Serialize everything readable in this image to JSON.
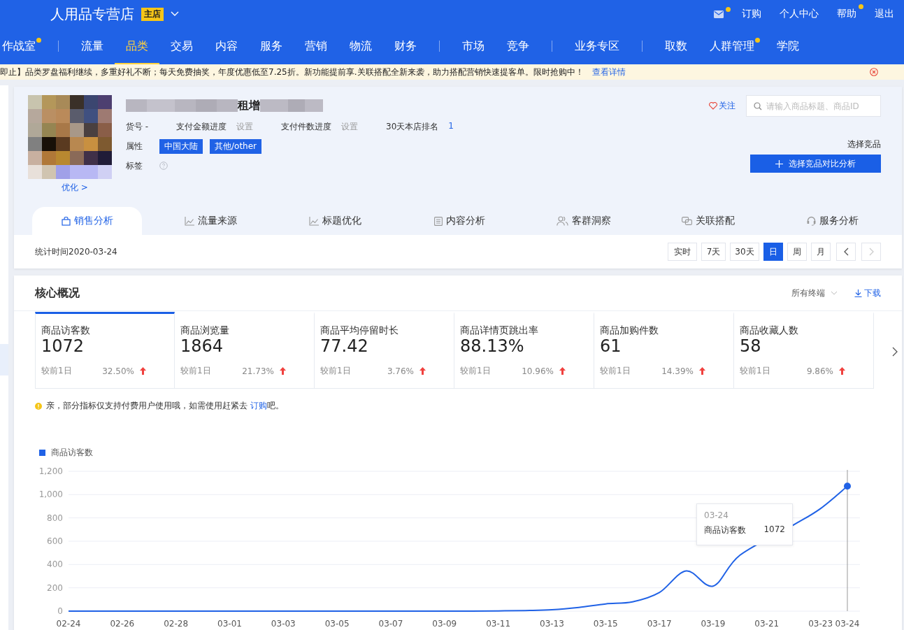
{
  "header": {
    "store_name": "人用品专营店",
    "store_badge": "主店",
    "links": [
      {
        "kind": "mail",
        "dot": true
      },
      {
        "label": "订购",
        "kind": "text",
        "dot": false
      },
      {
        "label": "个人中心",
        "kind": "text",
        "dot": false
      },
      {
        "label": "帮助",
        "kind": "text",
        "dot": true
      },
      {
        "label": "退出",
        "kind": "text",
        "dot": false
      }
    ]
  },
  "nav": [
    {
      "label": "作战室",
      "selected": false,
      "dot": true,
      "divider": true
    },
    {
      "label": "流量",
      "selected": false,
      "dot": false,
      "divider": false
    },
    {
      "label": "品类",
      "selected": true,
      "dot": false,
      "divider": false
    },
    {
      "label": "交易",
      "selected": false,
      "dot": false,
      "divider": false
    },
    {
      "label": "内容",
      "selected": false,
      "dot": false,
      "divider": false
    },
    {
      "label": "服务",
      "selected": false,
      "dot": false,
      "divider": false
    },
    {
      "label": "营销",
      "selected": false,
      "dot": false,
      "divider": false
    },
    {
      "label": "物流",
      "selected": false,
      "dot": false,
      "divider": false
    },
    {
      "label": "财务",
      "selected": false,
      "dot": false,
      "divider": true
    },
    {
      "label": "市场",
      "selected": false,
      "dot": false,
      "divider": false
    },
    {
      "label": "竞争",
      "selected": false,
      "dot": false,
      "divider": true
    },
    {
      "label": "业务专区",
      "selected": false,
      "dot": false,
      "divider": true
    },
    {
      "label": "取数",
      "selected": false,
      "dot": false,
      "divider": false
    },
    {
      "label": "人群管理",
      "selected": false,
      "dot": true,
      "divider": false
    },
    {
      "label": "学院",
      "selected": false,
      "dot": false,
      "divider": false
    }
  ],
  "notice": {
    "text": "即止】品类罗盘福利继续，多重好礼不断；每天免费抽奖，年度优惠低至7.25折。新功能提前享.关联搭配全新来袭，助力搭配营销快速提客单。限时抢购中！",
    "link": "查看详情"
  },
  "product": {
    "title": "租增",
    "optimize_link": "优化 >",
    "fields": [
      {
        "label": "货号 -"
      },
      {
        "label": "支付金额进度",
        "value": "设置"
      },
      {
        "label": "支付件数进度",
        "value": "设置"
      },
      {
        "label": "30天本店排名",
        "value": "1"
      }
    ],
    "attr_label": "属性",
    "attrs": [
      "中国大陆",
      "其他/other"
    ],
    "tag_label": "标签",
    "follow": "关注",
    "search_placeholder": "请输入商品标题、商品ID",
    "compare_label": "选择竞品",
    "compare_button": "选择竞品对比分析"
  },
  "tabs": [
    {
      "label": "销售分析",
      "selected": true
    },
    {
      "label": "流量来源",
      "selected": false
    },
    {
      "label": "标题优化",
      "selected": false
    },
    {
      "label": "内容分析",
      "selected": false
    },
    {
      "label": "客群洞察",
      "selected": false
    },
    {
      "label": "关联搭配",
      "selected": false
    },
    {
      "label": "服务分析",
      "selected": false
    }
  ],
  "stat_time": "统计时间2020-03-24",
  "periods": [
    {
      "label": "实时",
      "selected": false
    },
    {
      "label": "7天",
      "selected": false
    },
    {
      "label": "30天",
      "selected": false
    },
    {
      "label": "日",
      "selected": true
    },
    {
      "label": "周",
      "selected": false
    },
    {
      "label": "月",
      "selected": false
    }
  ],
  "pager": [
    {
      "kind": "prev",
      "disabled": false
    },
    {
      "kind": "next",
      "disabled": true
    }
  ],
  "overview": {
    "title": "核心概况",
    "terminal": "所有终端",
    "download": "下载",
    "metrics": [
      {
        "name": "商品访客数",
        "value": "1072",
        "compare": "较前1日",
        "change": "32.50%",
        "up": true,
        "selected": true
      },
      {
        "name": "商品浏览量",
        "value": "1864",
        "compare": "较前1日",
        "change": "21.73%",
        "up": true,
        "selected": false
      },
      {
        "name": "商品平均停留时长",
        "value": "77.42",
        "compare": "较前1日",
        "change": "3.76%",
        "up": true,
        "selected": false
      },
      {
        "name": "商品详情页跳出率",
        "value": "88.13%",
        "compare": "较前1日",
        "change": "10.96%",
        "up": true,
        "selected": false
      },
      {
        "name": "商品加购件数",
        "value": "61",
        "compare": "较前1日",
        "change": "14.39%",
        "up": true,
        "selected": false
      },
      {
        "name": "商品收藏人数",
        "value": "58",
        "compare": "较前1日",
        "change": "9.86%",
        "up": true,
        "selected": false
      }
    ],
    "tip_link": "订购",
    "tip_end": "吧。",
    "tip_start": "亲，部分指标仅支持付费用户使用哦，如需使用赶紧去 ",
    "chart_data": {
      "type": "line",
      "grid": true,
      "categories": [
        "02-24",
        null,
        "02-26",
        null,
        "02-28",
        null,
        "03-01",
        null,
        "03-03",
        null,
        "03-05",
        null,
        "03-07",
        null,
        "03-09",
        null,
        "03-11",
        null,
        "03-13",
        null,
        "03-15",
        null,
        "03-17",
        null,
        "03-19",
        null,
        "03-21",
        null,
        "03-23",
        "03-24"
      ],
      "series": [
        {
          "name": "商品访客数",
          "color": "#2062e6",
          "values": [
            0,
            0,
            0,
            0,
            0,
            0,
            0,
            0,
            0,
            0,
            0,
            0,
            0,
            0,
            0,
            0,
            2,
            5,
            12,
            32,
            62,
            80,
            160,
            345,
            215,
            480,
            null,
            740,
            880,
            1072
          ]
        }
      ],
      "ref_lines": [
        {
          "axis": "x",
          "value": "03-24"
        }
      ],
      "ylim": [
        0,
        1200
      ],
      "yticks": [
        {
          "value": 0,
          "label": "0"
        },
        {
          "value": 200,
          "label": "200"
        },
        {
          "value": 400,
          "label": "400"
        },
        {
          "value": 600,
          "label": "600"
        },
        {
          "value": 800,
          "label": "800"
        },
        {
          "value": 1000,
          "label": "1,000"
        },
        {
          "value": 1200,
          "label": "1,200"
        }
      ]
    },
    "tooltip": {
      "date": "03-24",
      "name": "商品访客数",
      "value": "1072"
    }
  }
}
